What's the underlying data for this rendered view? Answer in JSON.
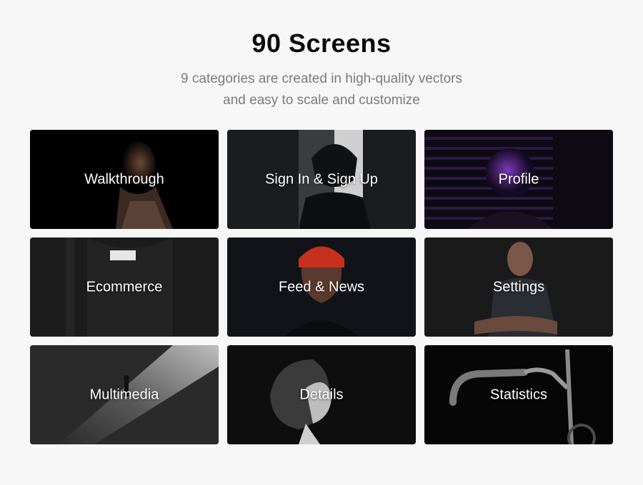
{
  "header": {
    "title": "90 Screens",
    "subtitle_line1": "9 categories are created in high-quality vectors",
    "subtitle_line2": "and easy to scale and customize"
  },
  "categories": [
    {
      "label": "Walkthrough"
    },
    {
      "label": "Sign In & Sign Up"
    },
    {
      "label": "Profile"
    },
    {
      "label": "Ecommerce"
    },
    {
      "label": "Feed & News"
    },
    {
      "label": "Settings"
    },
    {
      "label": "Multimedia"
    },
    {
      "label": "Details"
    },
    {
      "label": "Statistics"
    }
  ],
  "colors": {
    "background": "#f7f7f7",
    "title": "#0a0a0a",
    "subtitle": "#7b7b7b",
    "card_text": "#ffffff",
    "profile_accent": "#5a2a9a",
    "beanie_red": "#c8301e"
  }
}
